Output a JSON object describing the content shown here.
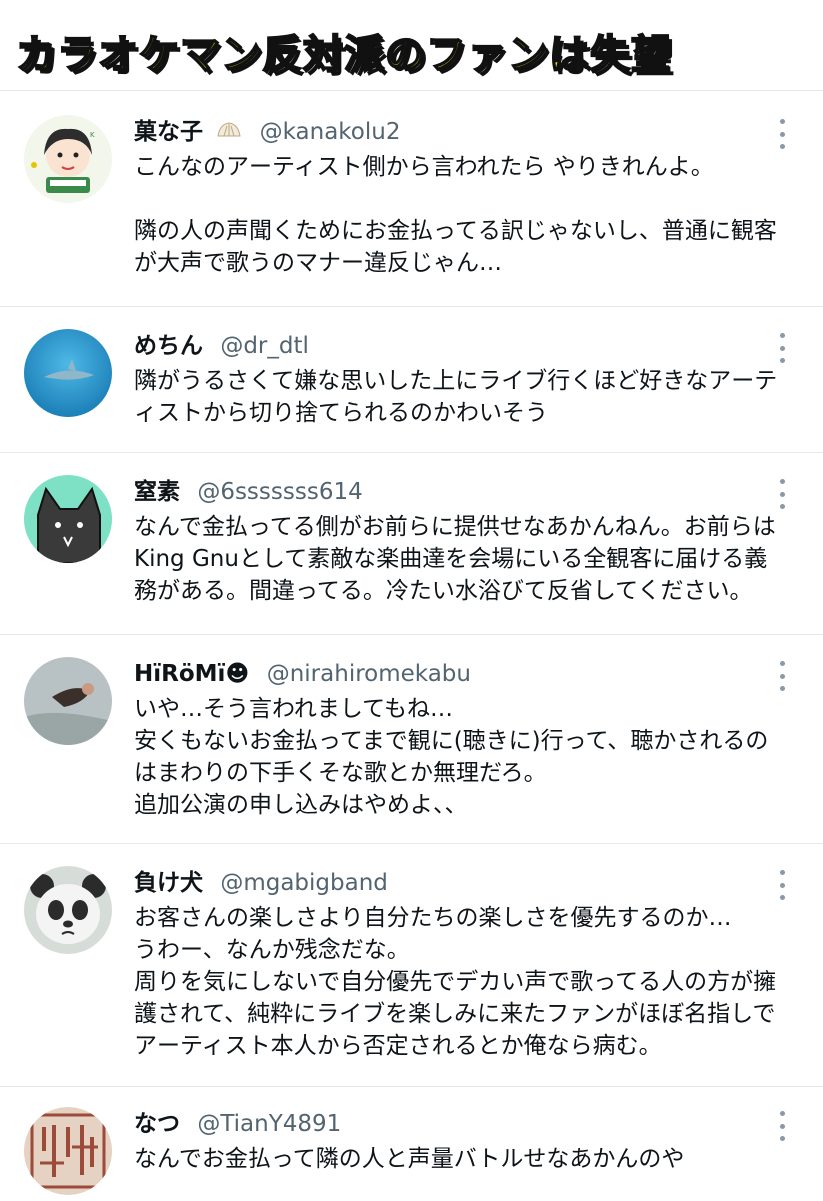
{
  "banner": {
    "title": "カラオケマン反対派のファンは失望"
  },
  "tweets": [
    {
      "name": "菓な子",
      "handle": "@kanakolu2",
      "lines": [
        "こんなのアーティスト側から言われたら やりきれんよ。",
        "",
        "隣の人の声聞くためにお金払ってる訳じゃないし、普通に観客",
        "が大声で歌うのマナー違反じゃん…"
      ]
    },
    {
      "name": "めちん",
      "handle": "@dr_dtl",
      "lines": [
        "隣がうるさくて嫌な思いした上にライブ行くほど好きなアーテ",
        "ィストから切り捨てられるのかわいそう"
      ]
    },
    {
      "name": "窒素",
      "handle": "@6sssssss614",
      "lines": [
        "なんで金払ってる側がお前らに提供せなあかんねん。お前らは",
        "King Gnuとして素敵な楽曲達を会場にいる全観客に届ける義",
        "務がある。間違ってる。冷たい水浴びて反省してください。"
      ]
    },
    {
      "name": "HïRöMï☻",
      "handle": "@nirahiromekabu",
      "lines": [
        "いや…そう言われましてもね…",
        "安くもないお金払ってまで観に(聴きに)行って、聴かされるの",
        "はまわりの下手くそな歌とか無理だろ。",
        "追加公演の申し込みはやめよ、、"
      ]
    },
    {
      "name": "負け犬",
      "handle": "@mgabigband",
      "lines": [
        "お客さんの楽しさより自分たちの楽しさを優先するのか…",
        "うわー、なんか残念だな。",
        "周りを気にしないで自分優先でデカい声で歌ってる人の方が擁",
        "護されて、純粋にライブを楽しみに来たファンがほぼ名指しで",
        "アーティスト本人から否定されるとか俺なら病む。"
      ]
    },
    {
      "name": "なつ",
      "handle": "@TianY4891",
      "lines": [
        "なんでお金払って隣の人と声量バトルせなあかんのや"
      ]
    }
  ],
  "icons": {
    "more": "more-options-icon",
    "badge": "shell-emoji-icon"
  }
}
